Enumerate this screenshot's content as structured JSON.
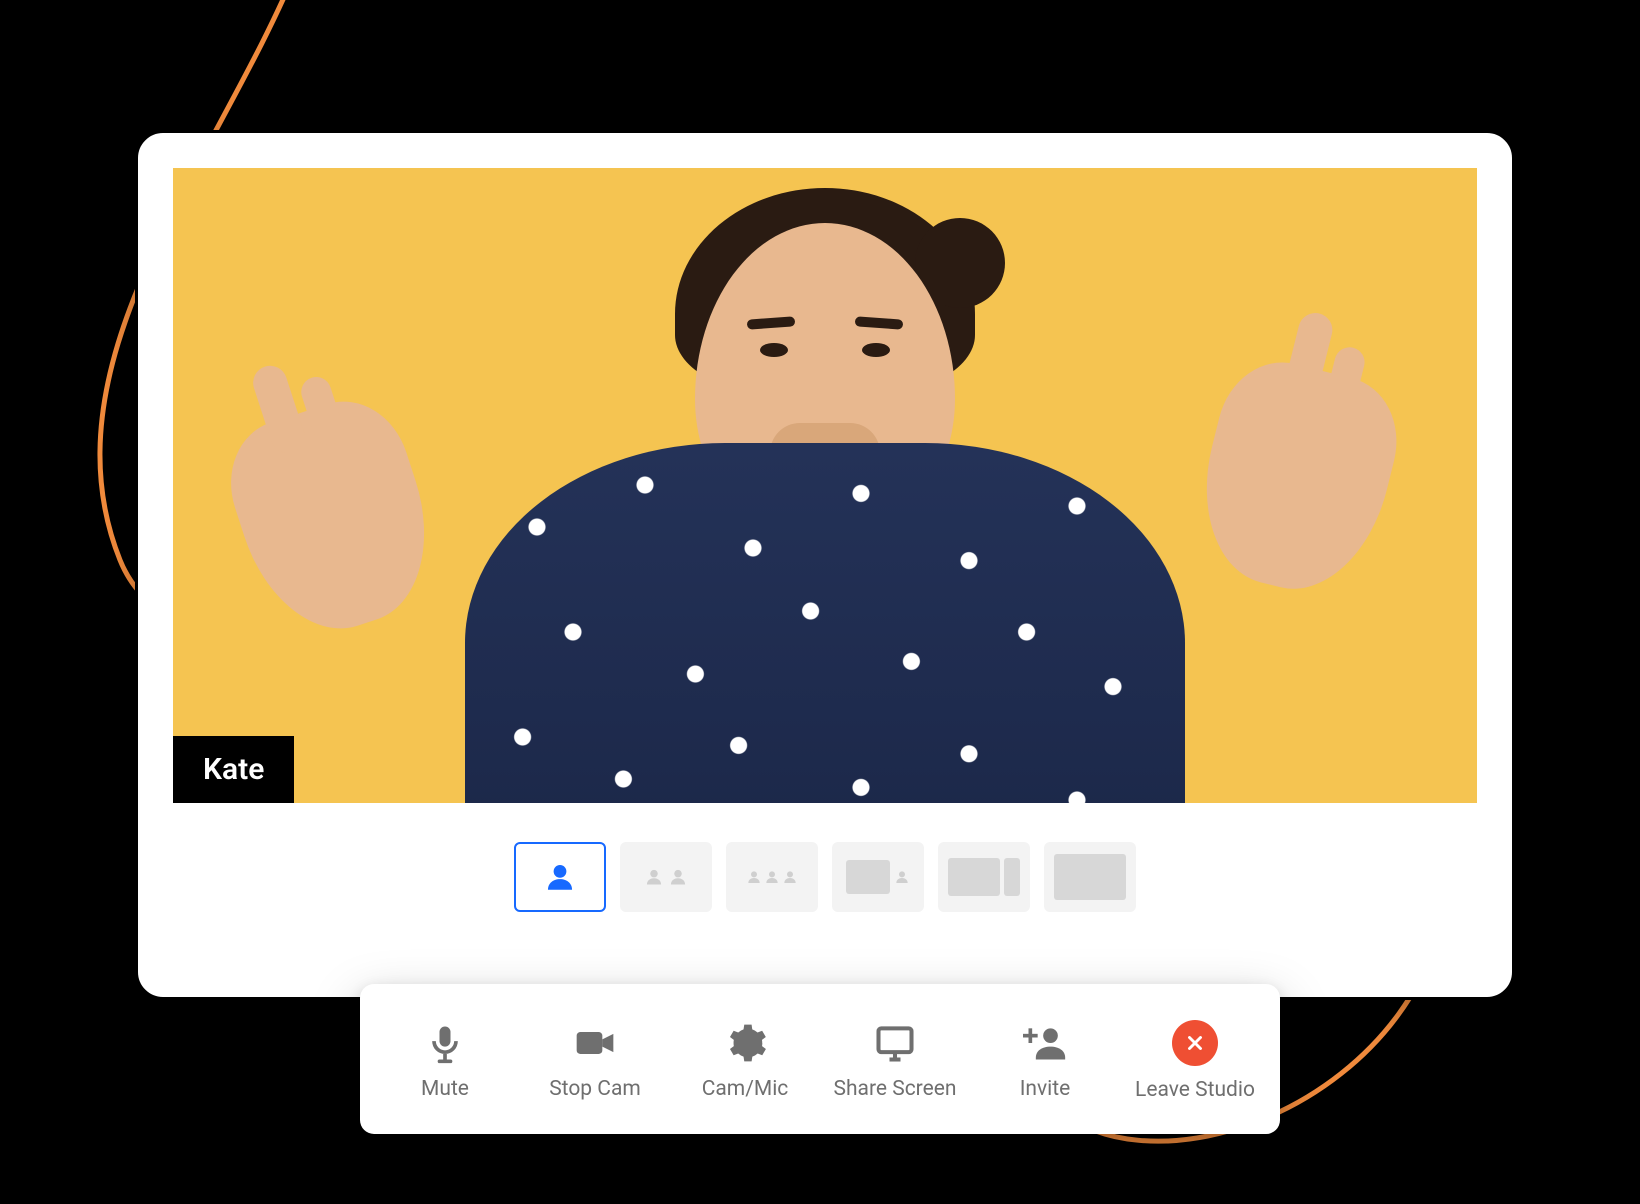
{
  "participant": {
    "name": "Kate"
  },
  "layouts": [
    {
      "id": "solo",
      "active": true
    },
    {
      "id": "two-up",
      "active": false
    },
    {
      "id": "three-up",
      "active": false
    },
    {
      "id": "screen-pip",
      "active": false
    },
    {
      "id": "screen-side",
      "active": false
    },
    {
      "id": "screen-full",
      "active": false
    }
  ],
  "toolbar": {
    "mute_label": "Mute",
    "stop_cam_label": "Stop Cam",
    "cam_mic_label": "Cam/Mic",
    "share_screen_label": "Share Screen",
    "invite_label": "Invite",
    "leave_label": "Leave Studio"
  },
  "colors": {
    "video_bg": "#f5c451",
    "accent_blue": "#1769ff",
    "leave_red": "#ef4f33",
    "swoosh": "#f08a3c"
  }
}
